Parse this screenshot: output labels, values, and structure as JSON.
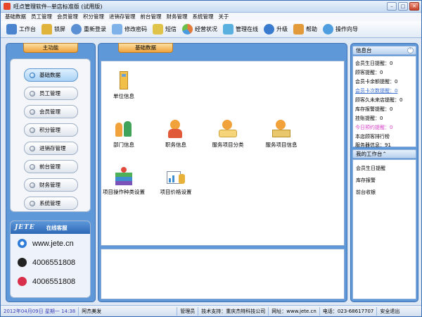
{
  "window": {
    "title": "旺点管理软件--单店标准版 (试用版)"
  },
  "menu": [
    "基础数据",
    "员工管理",
    "会员管理",
    "积分管理",
    "进销存管理",
    "前台管理",
    "财务管理",
    "系统管理",
    "关于"
  ],
  "toolbar": [
    {
      "label": "工作台",
      "icon": "desktop-icon",
      "color": "#4a84cf"
    },
    {
      "label": "锁屏",
      "icon": "lock-icon",
      "color": "#e0b33a"
    },
    {
      "label": "重新登录",
      "icon": "relogin-icon",
      "color": "#5b8fd4"
    },
    {
      "label": "修改密码",
      "icon": "password-icon",
      "color": "#7fb2e8"
    },
    {
      "label": "短信",
      "icon": "sms-icon",
      "color": "#e0c44a"
    },
    {
      "label": "经营状况",
      "icon": "business-chart-icon",
      "color": "#e57b3a"
    },
    {
      "label": "管理在线",
      "icon": "manage-online-icon",
      "color": "#5ab1e0"
    },
    {
      "label": "升级",
      "icon": "upgrade-icon",
      "color": "#3a7bd0"
    },
    {
      "label": "帮助",
      "icon": "help-icon",
      "color": "#e39a3a"
    },
    {
      "label": "操作向导",
      "icon": "wizard-icon",
      "color": "#4f9fe0"
    }
  ],
  "left": {
    "header": "主功能",
    "nav": [
      "基础数据",
      "员工管理",
      "会员管理",
      "积分管理",
      "进销存管理",
      "前台管理",
      "财务管理",
      "系统管理"
    ],
    "service": {
      "logo": "JETE",
      "online_label": "在线客服",
      "site": "www.jete.cn",
      "phone1": "4006551808",
      "phone2": "4006551808"
    }
  },
  "center": {
    "header": "基础数据",
    "items": [
      {
        "label": "单位信息",
        "icon": "company-info-icon"
      },
      {
        "label": "部门信息",
        "icon": "department-info-icon"
      },
      {
        "label": "职务信息",
        "icon": "position-info-icon"
      },
      {
        "label": "服务项目分类",
        "icon": "service-category-icon"
      },
      {
        "label": "服务项目信息",
        "icon": "service-item-icon"
      },
      {
        "label": "项目操作种类设置",
        "icon": "operation-type-icon"
      },
      {
        "label": "项目价格设置",
        "icon": "price-setting-icon"
      }
    ]
  },
  "right": {
    "info_header": "信息台",
    "info": [
      {
        "text": "会员生日提醒：0",
        "color": "#000000"
      },
      {
        "text": "顾客提醒：0",
        "color": "#000000"
      },
      {
        "text": "会员卡余额提醒：0",
        "color": "#000000"
      },
      {
        "text": "会员卡次数提醒：0",
        "color": "#3a6fd0"
      },
      {
        "text": "顾客久未来店提醒：0",
        "color": "#000000"
      },
      {
        "text": "库存报警提醒：0",
        "color": "#000000"
      },
      {
        "text": "挂账提醒：0",
        "color": "#000000"
      },
      {
        "text": "今日预约提醒：0",
        "color": "#d43fc8"
      },
      {
        "text": "本店顾客排行榜",
        "color": "#000000"
      },
      {
        "text": "服务器信息：91",
        "color": "#000000"
      }
    ],
    "work_header": "我的工作台",
    "work": [
      "会员生日提醒",
      "库存报警",
      "前台收银"
    ]
  },
  "status": {
    "datetime": "2012年04月09日 星期一 14:38",
    "user": "阿杰美发",
    "role": "管理员",
    "support": "技术支持：重庆杰特科技公司",
    "website": "网址：www.jete.cn",
    "phone": "电话：023-68617707",
    "exit": "安全退出"
  }
}
